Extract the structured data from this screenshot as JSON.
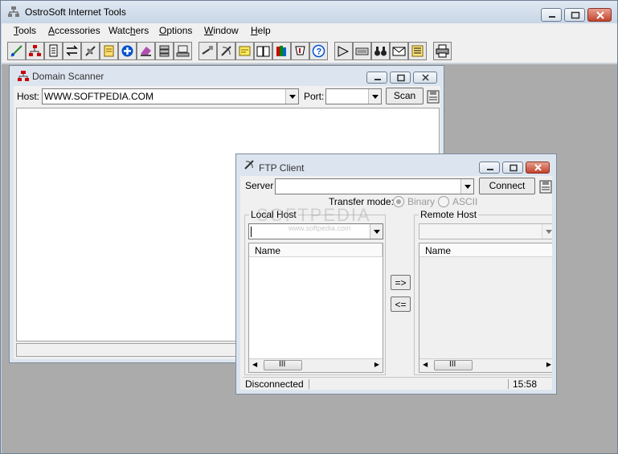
{
  "app": {
    "title": "OstroSoft Internet Tools"
  },
  "menu": [
    {
      "label": "Tools",
      "key": "T"
    },
    {
      "label": "Accessories",
      "key": "A"
    },
    {
      "label": "Watchers",
      "key": "h"
    },
    {
      "label": "Options",
      "key": "O"
    },
    {
      "label": "Window",
      "key": "W"
    },
    {
      "label": "Help",
      "key": "H"
    }
  ],
  "domain_scanner": {
    "title": "Domain Scanner",
    "host_label": "Host:",
    "host_value": "WWW.SOFTPEDIA.COM",
    "port_label": "Port:",
    "port_value": "",
    "scan_label": "Scan"
  },
  "ftp_client": {
    "title": "FTP Client",
    "server_label": "Server",
    "server_value": "",
    "connect_label": "Connect",
    "transfer_mode_label": "Transfer mode:",
    "mode_binary": "Binary",
    "mode_ascii": "ASCII",
    "local_host_label": "Local Host",
    "remote_host_label": "Remote Host",
    "name_col": "Name",
    "upload_label": "=>",
    "download_label": "<=",
    "scroll_thumb": "III",
    "status_text": "Disconnected",
    "status_time": "15:58",
    "watermark": "SOFTPEDIA",
    "watermark_url": "www.softpedia.com"
  },
  "colors": {
    "accent": "#0050d0",
    "titlebar": "#c8d6e6",
    "close": "#c2432d"
  }
}
